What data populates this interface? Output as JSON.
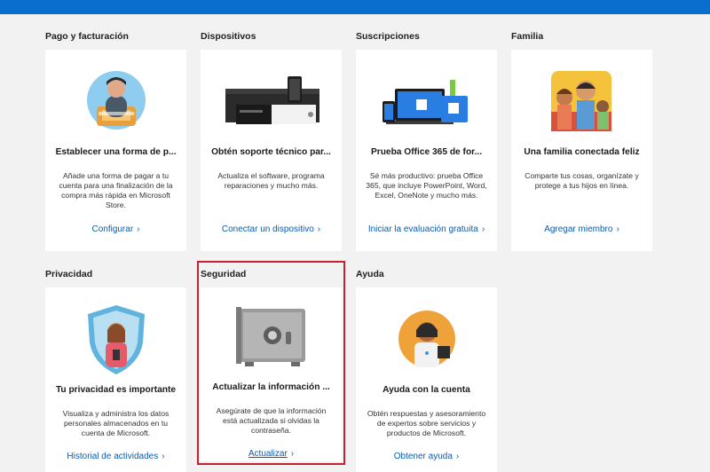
{
  "sections": [
    {
      "label": "Pago y facturación",
      "title": "Establecer una forma de p...",
      "desc": "Añade una forma de pagar a tu cuenta para una finalización de la compra más rápida en Microsoft Store.",
      "link": "Configurar"
    },
    {
      "label": "Dispositivos",
      "title": "Obtén soporte técnico par...",
      "desc": "Actualiza el software, programa reparaciones y mucho más.",
      "link": "Conectar un dispositivo"
    },
    {
      "label": "Suscripciones",
      "title": "Prueba Office 365 de for...",
      "desc": "Sé más productivo: prueba Office 365, que incluye PowerPoint, Word, Excel, OneNote y mucho más.",
      "link": "Iniciar la evaluación gratuita"
    },
    {
      "label": "Familia",
      "title": "Una familia conectada feliz",
      "desc": "Comparte tus cosas, organízate y protege a tus hijos en línea.",
      "link": "Agregar miembro"
    },
    {
      "label": "Privacidad",
      "title": "Tu privacidad es importante",
      "desc": "Visualiza y administra los datos personales almacenados en tu cuenta de Microsoft.",
      "link": "Historial de actividades"
    },
    {
      "label": "Seguridad",
      "title": "Actualizar la información ...",
      "desc": "Asegúrate de que la información está actualizada si olvidas la contraseña.",
      "link": "Actualizar"
    },
    {
      "label": "Ayuda",
      "title": "Ayuda con la cuenta",
      "desc": "Obtén respuestas y asesoramiento de expertos sobre servicios y productos de Microsoft.",
      "link": "Obtener ayuda"
    }
  ],
  "chevron": "›",
  "colors": {
    "topbar": "#0a6ecf",
    "link": "#0b5cad",
    "highlight": "#c8202f"
  }
}
